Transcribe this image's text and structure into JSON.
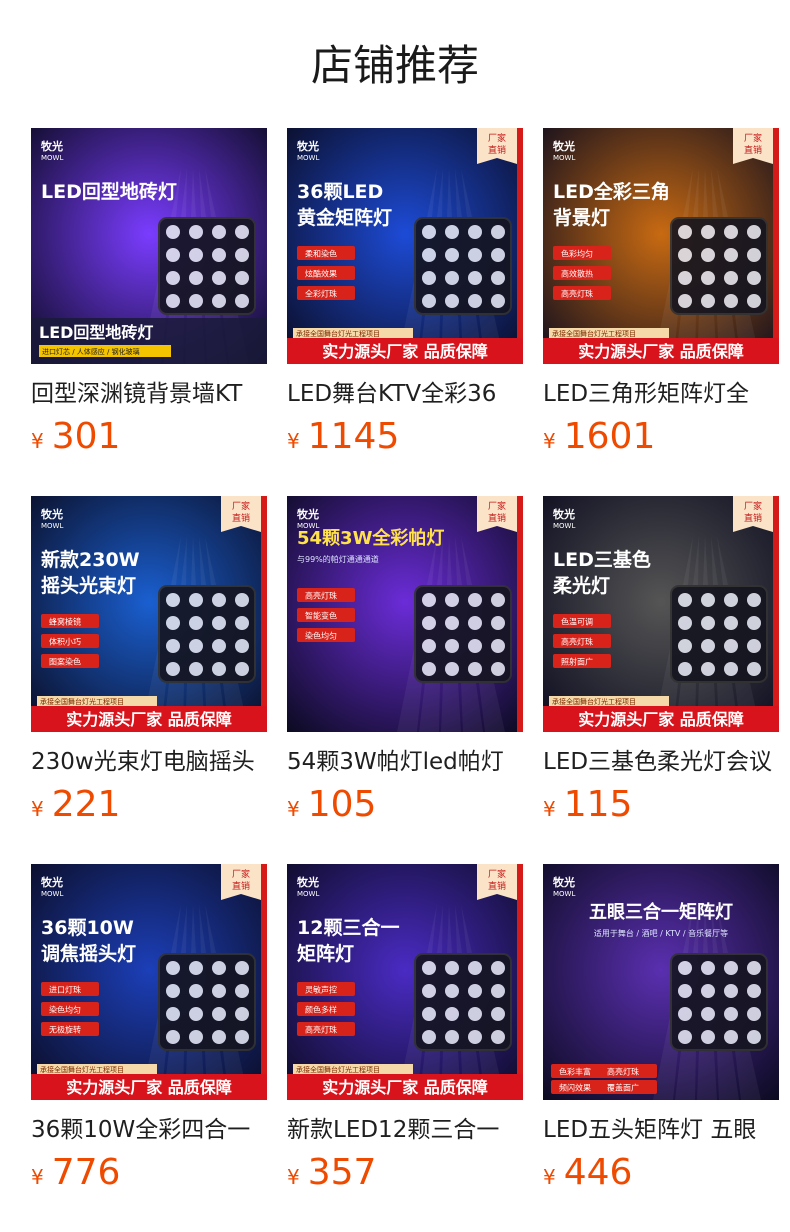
{
  "section": {
    "title": "店铺推荐"
  },
  "brand": {
    "logo": "牧光",
    "logo_en": "MOWL"
  },
  "common": {
    "corner_badge": [
      "厂家",
      "直销"
    ],
    "footer_banner": "实力源头厂家 品质保障",
    "footer_tag": "承接全国舞台灯光工程项目",
    "currency": "¥"
  },
  "products": [
    {
      "name": "回型深渊镜背景墙KT",
      "price": "301",
      "image": {
        "headline": "LED回型地砖灯",
        "sub": "进口灯芯 / 人体感应 / 钢化玻璃",
        "features": [],
        "accent": "#7a3cff"
      }
    },
    {
      "name": "LED舞台KTV全彩36",
      "price": "1145",
      "image": {
        "headline": "36颗LED",
        "headline2": "黄金矩阵灯",
        "features": [
          "柔和染色",
          "炫酷效果",
          "全彩灯珠"
        ],
        "accent": "#1d4bd6"
      }
    },
    {
      "name": "LED三角形矩阵灯全",
      "price": "1601",
      "image": {
        "headline": "LED全彩三角",
        "headline2": "背景灯",
        "features": [
          "色彩均匀",
          "高效散热",
          "高亮灯珠"
        ],
        "accent": "#c86a12"
      }
    },
    {
      "name": "230w光束灯电脑摇头",
      "price": "221",
      "image": {
        "headline": "新款230W",
        "headline2": "摇头光束灯",
        "features": [
          "蜂窝棱镜",
          "体积小巧",
          "图案染色"
        ],
        "accent": "#1a5fd0"
      }
    },
    {
      "name": "54颗3W帕灯led帕灯",
      "price": "105",
      "image": {
        "headline": "54颗3W全彩帕灯",
        "sub": "与99%的帕灯通通通道",
        "features": [
          "高亮灯珠",
          "智能变色",
          "染色均匀"
        ],
        "accent": "#6b2cd8"
      }
    },
    {
      "name": "LED三基色柔光灯会议",
      "price": "115",
      "image": {
        "headline": "LED三基色",
        "headline2": "柔光灯",
        "features": [
          "色温可调",
          "高亮灯珠",
          "照射面广"
        ],
        "accent": "#555555"
      }
    },
    {
      "name": "36颗10W全彩四合一",
      "price": "776",
      "image": {
        "headline": "36颗10W",
        "headline2": "调焦摇头灯",
        "features": [
          "进口灯珠",
          "染色均匀",
          "无极旋转"
        ],
        "accent": "#1c3fb8"
      }
    },
    {
      "name": "新款LED12颗三合一",
      "price": "357",
      "image": {
        "headline": "12颗三合一",
        "headline2": "矩阵灯",
        "features": [
          "灵敏声控",
          "颜色多样",
          "高亮灯珠"
        ],
        "accent": "#4a2bc4"
      }
    },
    {
      "name": "LED五头矩阵灯 五眼",
      "price": "446",
      "image": {
        "headline": "五眼三合一矩阵灯",
        "sub": "适用于舞台 / 酒吧 / KTV / 音乐餐厅等",
        "features": [
          "色彩丰富",
          "高亮灯珠",
          "频闪效果",
          "覆盖面广"
        ],
        "accent": "#5a2fb0"
      }
    }
  ]
}
